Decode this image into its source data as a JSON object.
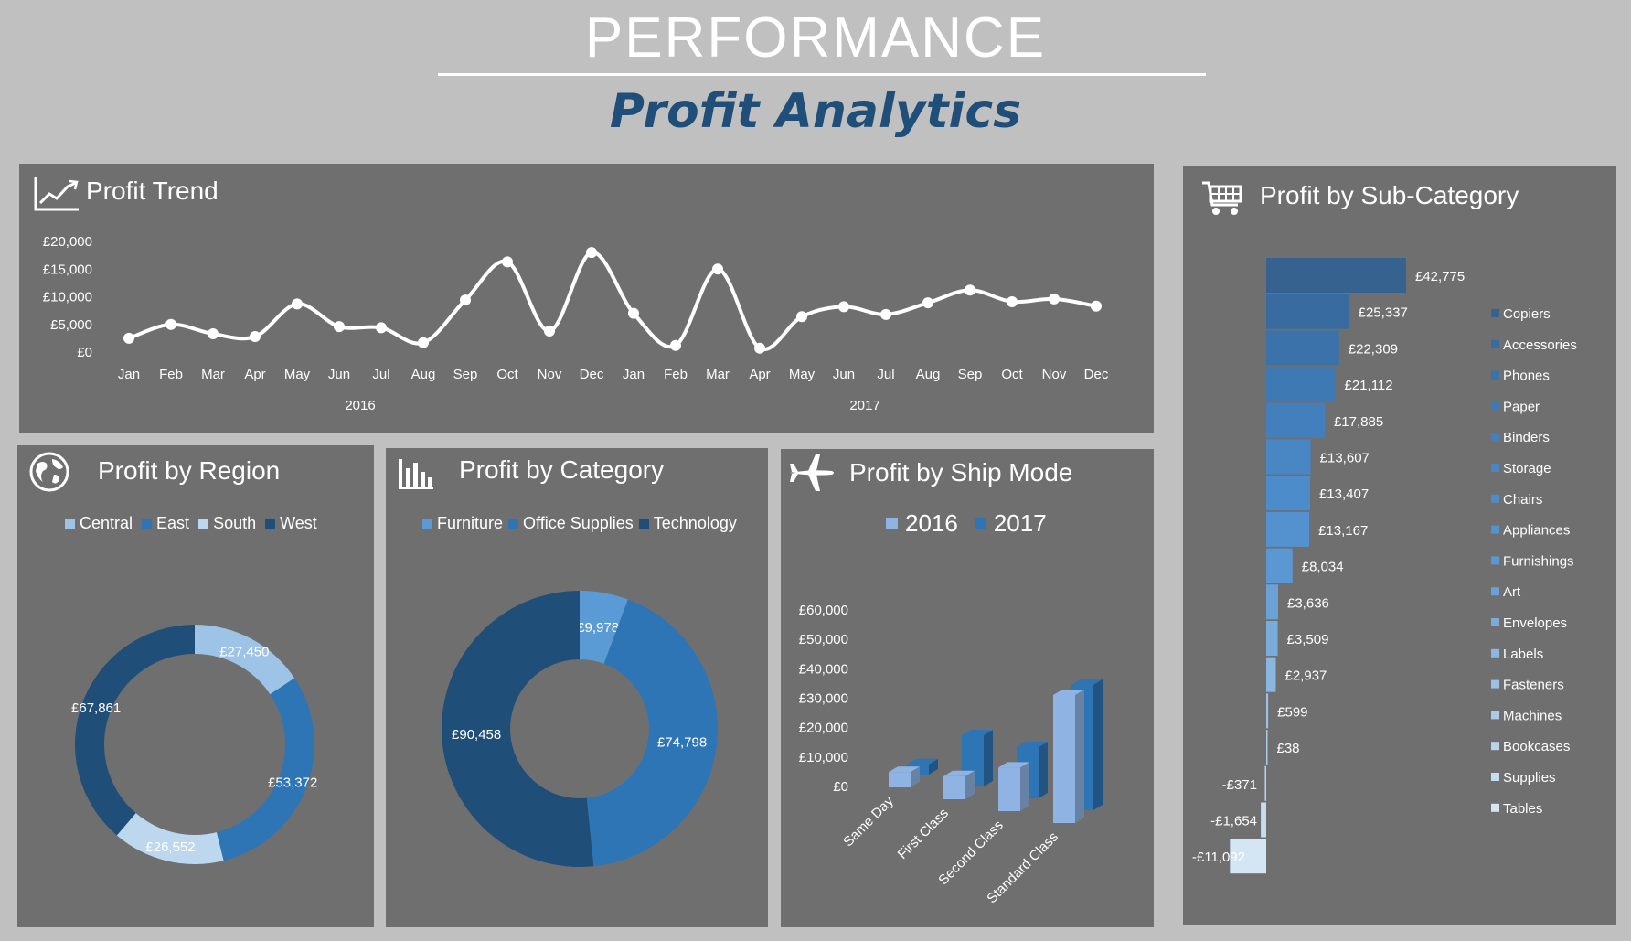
{
  "header": {
    "title": "PERFORMANCE",
    "subtitle": "Profit Analytics"
  },
  "panels": {
    "trend": {
      "title": "Profit Trend",
      "icon": "line-chart-icon"
    },
    "region": {
      "title": "Profit by Region",
      "icon": "globe-icon"
    },
    "category": {
      "title": "Profit by Category",
      "icon": "bar-chart-icon"
    },
    "shipmode": {
      "title": "Profit by Ship Mode",
      "icon": "airplane-icon"
    },
    "subcategory": {
      "title": "Profit by Sub-Category",
      "icon": "shopping-cart-icon"
    }
  },
  "chart_data": [
    {
      "id": "trend",
      "type": "line",
      "x": [
        "Jan",
        "Feb",
        "Mar",
        "Apr",
        "May",
        "Jun",
        "Jul",
        "Aug",
        "Sep",
        "Oct",
        "Nov",
        "Dec",
        "Jan",
        "Feb",
        "Mar",
        "Apr",
        "May",
        "Jun",
        "Jul",
        "Aug",
        "Sep",
        "Oct",
        "Nov",
        "Dec"
      ],
      "groups": [
        {
          "label": "2016",
          "start": 0,
          "end": 11
        },
        {
          "label": "2017",
          "start": 12,
          "end": 23
        }
      ],
      "values": [
        2500,
        5000,
        3300,
        2800,
        8700,
        4600,
        4400,
        1700,
        9400,
        16300,
        3800,
        18000,
        7000,
        1200,
        15000,
        700,
        6400,
        8200,
        6800,
        8900,
        11200,
        9100,
        9600,
        8300
      ],
      "yticks": [
        "£0",
        "£5,000",
        "£10,000",
        "£15,000",
        "£20,000"
      ],
      "ylim": [
        0,
        20000
      ],
      "color": "#ffffff"
    },
    {
      "id": "region",
      "type": "pie",
      "donut": true,
      "legend": [
        "Central",
        "East",
        "South",
        "West"
      ],
      "slices": [
        {
          "name": "Central",
          "value": 27450,
          "label": "£27,450",
          "color": "#9dc3e6"
        },
        {
          "name": "East",
          "value": 53372,
          "label": "£53,372",
          "color": "#2e75b6"
        },
        {
          "name": "South",
          "value": 26552,
          "label": "£26,552",
          "color": "#bdd7ee"
        },
        {
          "name": "West",
          "value": 67861,
          "label": "£67,861",
          "color": "#1f4e79"
        }
      ]
    },
    {
      "id": "category",
      "type": "pie",
      "donut": true,
      "legend": [
        "Furniture",
        "Office Supplies",
        "Technology"
      ],
      "slices": [
        {
          "name": "Furniture",
          "value": 9978,
          "label": "£9,978",
          "color": "#5b9bd5"
        },
        {
          "name": "Office Supplies",
          "value": 74798,
          "label": "£74,798",
          "color": "#2e75b6"
        },
        {
          "name": "Technology",
          "value": 90458,
          "label": "£90,458",
          "color": "#1f4e79"
        }
      ]
    },
    {
      "id": "shipmode",
      "type": "bar",
      "categories": [
        "Same Day",
        "First Class",
        "Second Class",
        "Standard Class"
      ],
      "series": [
        {
          "name": "2016",
          "values": [
            6000,
            9000,
            17000,
            50000
          ],
          "color": "#8fb4e3"
        },
        {
          "name": "2017",
          "values": [
            4000,
            20000,
            20000,
            49000
          ],
          "color": "#2e75b6"
        }
      ],
      "yticks": [
        "£0",
        "£10,000",
        "£20,000",
        "£30,000",
        "£40,000",
        "£50,000",
        "£60,000"
      ],
      "ylim": [
        0,
        60000
      ]
    },
    {
      "id": "subcategory",
      "type": "bar",
      "orientation": "horizontal",
      "categories": [
        "Copiers",
        "Accessories",
        "Phones",
        "Paper",
        "Binders",
        "Storage",
        "Chairs",
        "Appliances",
        "Furnishings",
        "Art",
        "Envelopes",
        "Labels",
        "Fasteners",
        "Machines",
        "Bookcases",
        "Supplies",
        "Tables"
      ],
      "values": [
        42775,
        25337,
        22309,
        21112,
        17885,
        13607,
        13407,
        13167,
        8034,
        3636,
        3509,
        2937,
        599,
        38,
        -371,
        -1654,
        -11092
      ],
      "labels": [
        "£42,775",
        "£25,337",
        "£22,309",
        "£21,112",
        "£17,885",
        "£13,607",
        "£13,407",
        "£13,167",
        "£8,034",
        "£3,636",
        "£3,509",
        "£2,937",
        "£599",
        "£38",
        "-£371",
        "-£1,654",
        "-£11,092"
      ],
      "colors": [
        "#35628f",
        "#386b9f",
        "#3c72aa",
        "#3f79b4",
        "#437fbd",
        "#4886c4",
        "#4d8cca",
        "#5392cf",
        "#5b98d3",
        "#6aa2d7",
        "#7aacdb",
        "#8ab6df",
        "#9ac0e3",
        "#aacae8",
        "#b8d3ec",
        "#c6dcf0",
        "#d4e5f4"
      ]
    }
  ]
}
